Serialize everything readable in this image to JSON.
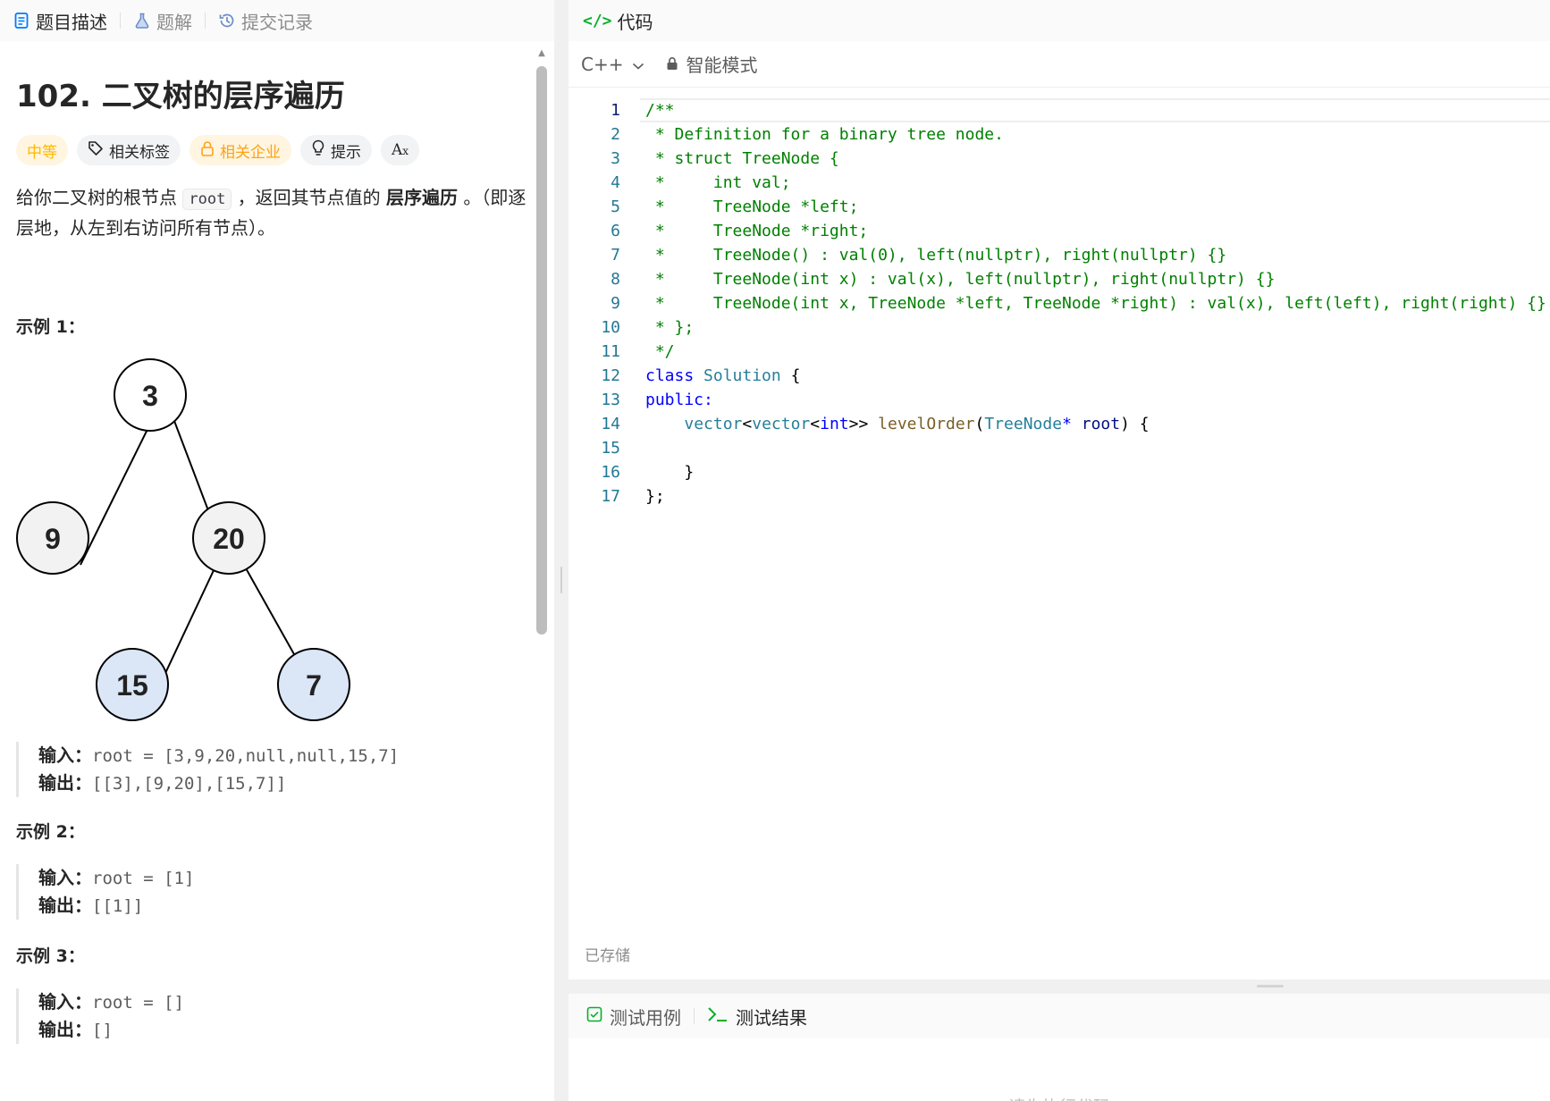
{
  "left_tabs": [
    {
      "label": "题目描述",
      "icon": "description-icon",
      "active": true
    },
    {
      "label": "题解",
      "icon": "flask-icon",
      "active": false
    },
    {
      "label": "提交记录",
      "icon": "history-icon",
      "active": false
    }
  ],
  "problem": {
    "title": "102. 二叉树的层序遍历",
    "tags": {
      "difficulty": "中等",
      "topics": "相关标签",
      "companies": "相关企业",
      "hint": "提示",
      "translate": "Aあ"
    },
    "description": {
      "part1": "给你二叉树的根节点 ",
      "code": "root",
      "part2": " ，返回其节点值的 ",
      "bold": "层序遍历",
      "part3": " 。（即逐层地，从左到右访问所有节点）。"
    }
  },
  "examples": [
    {
      "heading": "示例 1：",
      "input_label": "输入：",
      "input": "root = [3,9,20,null,null,15,7]",
      "output_label": "输出：",
      "output": "[[3],[9,20],[15,7]]"
    },
    {
      "heading": "示例 2：",
      "input_label": "输入：",
      "input": "root = [1]",
      "output_label": "输出：",
      "output": "[[1]]"
    },
    {
      "heading": "示例 3：",
      "input_label": "输入：",
      "input": "root = []",
      "output_label": "输出：",
      "output": "[]"
    }
  ],
  "tree": {
    "nodes": [
      "3",
      "9",
      "20",
      "15",
      "7"
    ],
    "node_fill_top": "#f2f2f2",
    "node_fill_leaf": "#dbe6f7"
  },
  "code_panel": {
    "title": "代码",
    "language": "C++",
    "mode": "智能模式",
    "saved_status": "已存储"
  },
  "code_lines": [
    {
      "n": "1",
      "cur": true,
      "seg": [
        {
          "c": "cm",
          "t": "/**"
        }
      ]
    },
    {
      "n": "2",
      "seg": [
        {
          "c": "cm",
          "t": " * Definition for a binary tree node."
        }
      ]
    },
    {
      "n": "3",
      "seg": [
        {
          "c": "cm",
          "t": " * struct TreeNode {"
        }
      ]
    },
    {
      "n": "4",
      "seg": [
        {
          "c": "cm",
          "t": " *     int val;"
        }
      ]
    },
    {
      "n": "5",
      "seg": [
        {
          "c": "cm",
          "t": " *     TreeNode *left;"
        }
      ]
    },
    {
      "n": "6",
      "seg": [
        {
          "c": "cm",
          "t": " *     TreeNode *right;"
        }
      ]
    },
    {
      "n": "7",
      "seg": [
        {
          "c": "cm",
          "t": " *     TreeNode() : val(0), left(nullptr), right(nullptr) {}"
        }
      ]
    },
    {
      "n": "8",
      "seg": [
        {
          "c": "cm",
          "t": " *     TreeNode(int x) : val(x), left(nullptr), right(nullptr) {}"
        }
      ]
    },
    {
      "n": "9",
      "seg": [
        {
          "c": "cm",
          "t": " *     TreeNode(int x, TreeNode *left, TreeNode *right) : val(x), left(left), right(right) {}"
        }
      ]
    },
    {
      "n": "10",
      "seg": [
        {
          "c": "cm",
          "t": " * };"
        }
      ]
    },
    {
      "n": "11",
      "seg": [
        {
          "c": "cm",
          "t": " */"
        }
      ]
    },
    {
      "n": "12",
      "seg": [
        {
          "c": "kw",
          "t": "class"
        },
        {
          "c": "",
          "t": " "
        },
        {
          "c": "ty",
          "t": "Solution"
        },
        {
          "c": "",
          "t": " {"
        }
      ]
    },
    {
      "n": "13",
      "seg": [
        {
          "c": "kw",
          "t": "public:"
        }
      ]
    },
    {
      "n": "14",
      "seg": [
        {
          "c": "",
          "t": "    "
        },
        {
          "c": "ty",
          "t": "vector"
        },
        {
          "c": "",
          "t": "<"
        },
        {
          "c": "ty",
          "t": "vector"
        },
        {
          "c": "",
          "t": "<"
        },
        {
          "c": "kw",
          "t": "int"
        },
        {
          "c": "",
          "t": ">> "
        },
        {
          "c": "fn",
          "t": "levelOrder"
        },
        {
          "c": "",
          "t": "("
        },
        {
          "c": "ty",
          "t": "TreeNode"
        },
        {
          "c": "kw",
          "t": "*"
        },
        {
          "c": "",
          "t": " "
        },
        {
          "c": "pm",
          "t": "root"
        },
        {
          "c": "",
          "t": ") {"
        }
      ]
    },
    {
      "n": "15",
      "seg": [
        {
          "c": "",
          "t": ""
        }
      ]
    },
    {
      "n": "16",
      "seg": [
        {
          "c": "",
          "t": "    }"
        }
      ]
    },
    {
      "n": "17",
      "seg": [
        {
          "c": "",
          "t": "};"
        }
      ]
    }
  ],
  "bottom_tabs": [
    {
      "label": "测试用例",
      "icon": "checkbox-icon",
      "active": false
    },
    {
      "label": "测试结果",
      "icon": "terminal-icon",
      "active": true
    }
  ],
  "bottom_hint": "请先执行代码",
  "colors": {
    "accent_green": "#02b128",
    "difficulty": "#ffb800"
  }
}
